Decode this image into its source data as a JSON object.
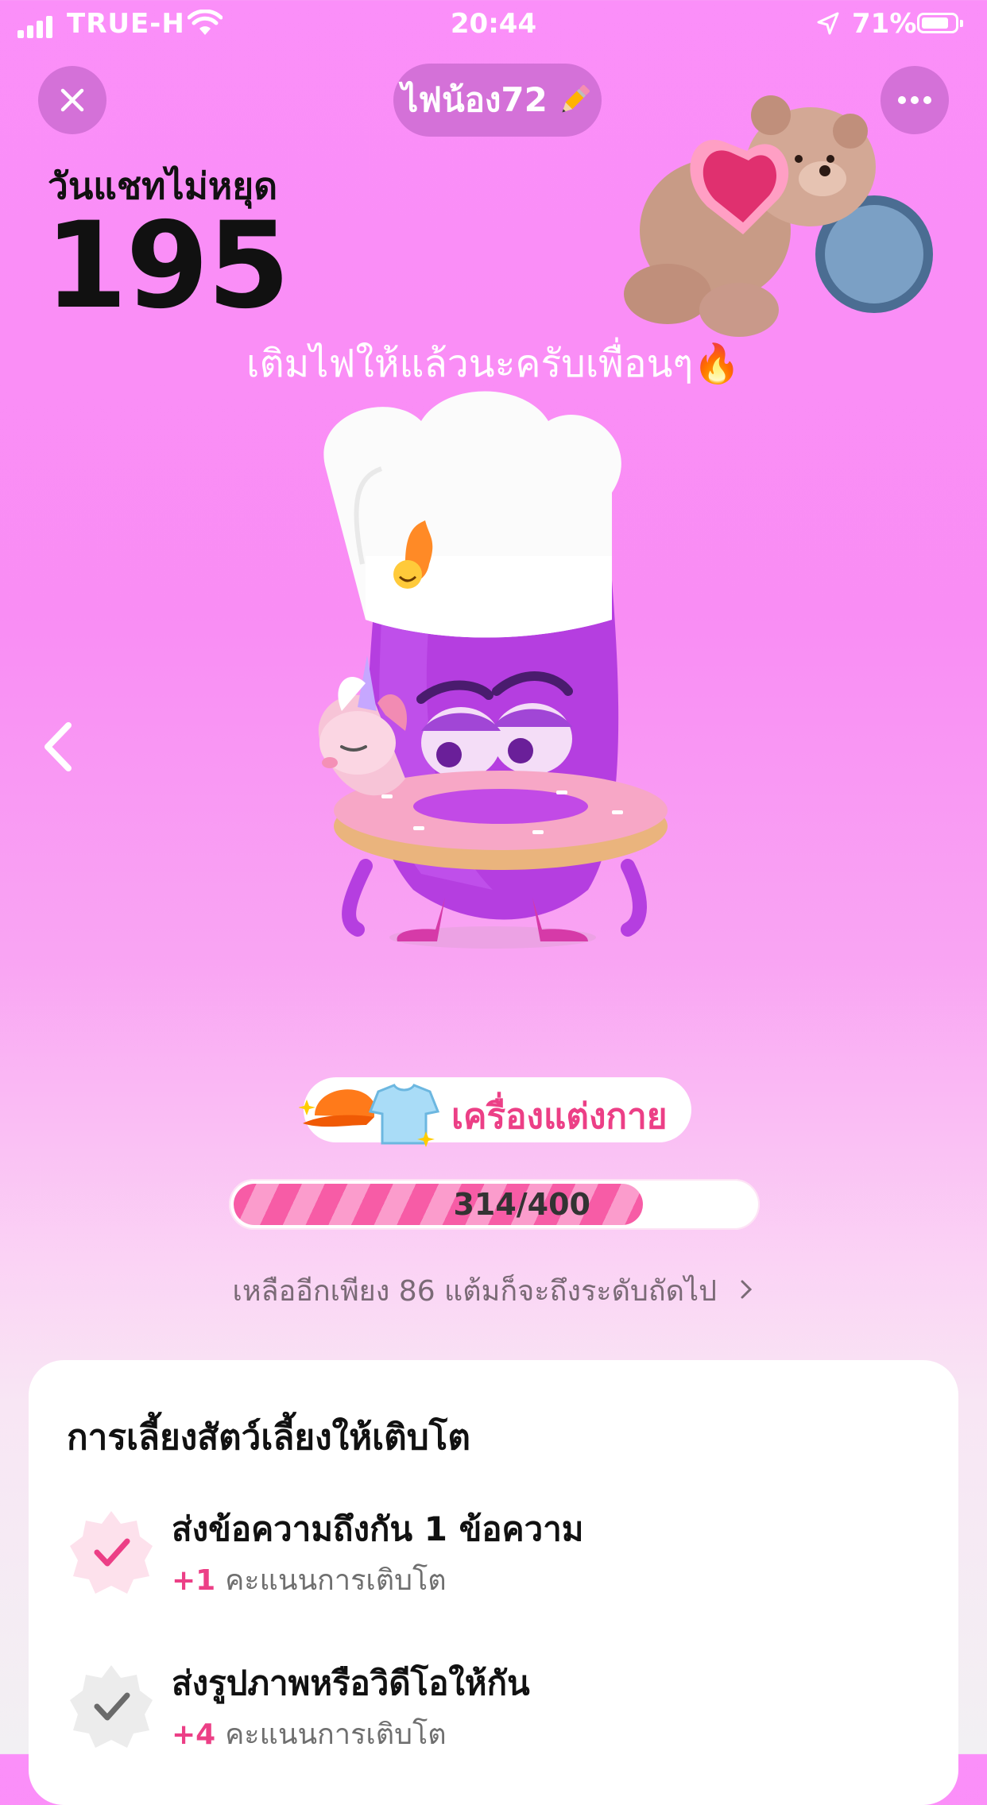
{
  "status_bar": {
    "carrier": "TRUE-H",
    "time": "20:44",
    "battery": "71%",
    "battery_level": 0.71
  },
  "header": {
    "title": "ไฟน้อง72",
    "edit_icon": "pencil-icon",
    "close_icon": "close-icon",
    "more_icon": "more-icon"
  },
  "streak": {
    "label": "วันแชทไม่หยุด",
    "days": "195"
  },
  "message": "เติมไฟให้แล้วนะครับเพื่อนๆ🔥",
  "accessory": {
    "label": "เครื่องแต่งกาย",
    "icons": [
      "cap-icon",
      "tshirt-icon"
    ]
  },
  "progress": {
    "text": "314/400",
    "current": 314,
    "max": 400
  },
  "remaining_text": "เหลืออีกเพียง 86 แต้มก็จะถึงระดับถัดไป",
  "colors": {
    "accent_pink": "#ec3f86",
    "background_pink": "#fb8ff9",
    "stripe_pink": "#f75ca6"
  },
  "growth_card": {
    "heading": "การเลี้ยงสัตว์เลี้ยงให้เติบโต",
    "tasks": [
      {
        "title": "ส่งข้อความถึงกัน 1 ข้อความ",
        "points": "+1",
        "points_label": "คะแนนการเติบโต",
        "completed": true
      },
      {
        "title": "ส่งรูปภาพหรือวิดีโอให้กัน",
        "points": "+4",
        "points_label": "คะแนนการเติบโต",
        "completed": false
      }
    ]
  }
}
